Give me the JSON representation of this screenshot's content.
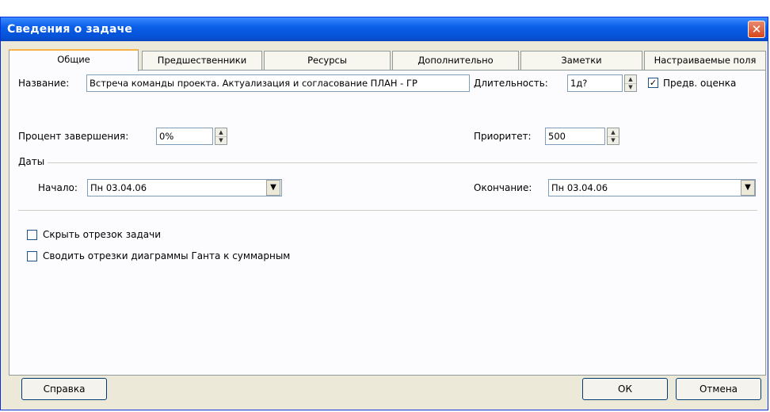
{
  "window": {
    "title": "Сведения о задаче",
    "close_glyph": "✕"
  },
  "tabs": [
    {
      "label": "Общие",
      "active": true
    },
    {
      "label": "Предшественники",
      "active": false
    },
    {
      "label": "Ресурсы",
      "active": false
    },
    {
      "label": "Дополнительно",
      "active": false
    },
    {
      "label": "Заметки",
      "active": false
    },
    {
      "label": "Настраиваемые поля",
      "active": false
    }
  ],
  "general": {
    "name_label": "Название:",
    "name_value": "Встреча команды проекта. Актуализация и согласование ПЛАН - ГР",
    "duration_label": "Длительность:",
    "duration_value": "1д?",
    "estimated_label": "Предв. оценка",
    "estimated_checked": true,
    "percent_label": "Процент завершения:",
    "percent_value": "0%",
    "priority_label": "Приоритет:",
    "priority_value": "500",
    "dates_group_label": "Даты",
    "start_label": "Начало:",
    "start_value": "Пн 03.04.06",
    "finish_label": "Окончание:",
    "finish_value": "Пн 03.04.06",
    "hide_bar_label": "Скрыть отрезок задачи",
    "hide_bar_checked": false,
    "rollup_label": "Сводить отрезки диаграммы Ганта к суммарным",
    "rollup_checked": false
  },
  "buttons": {
    "help": "Справка",
    "ok": "ОК",
    "cancel": "Отмена"
  },
  "icons": {
    "check_glyph": "✓",
    "spin_up": "▲",
    "spin_down": "▼",
    "dropdown": "▼"
  }
}
